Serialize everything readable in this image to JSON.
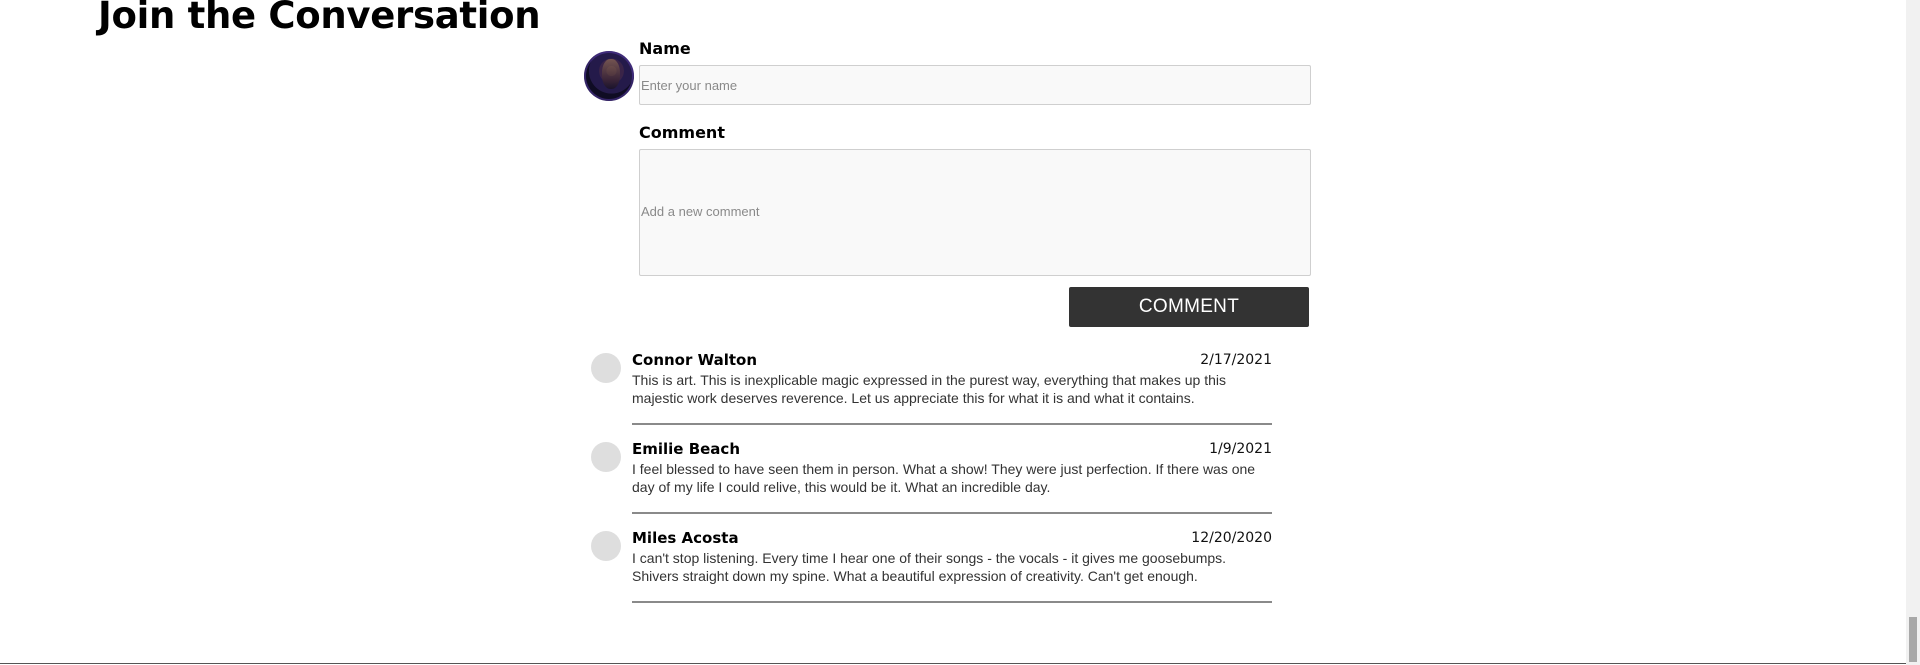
{
  "section": {
    "title": "Join the Conversation"
  },
  "form": {
    "name_label": "Name",
    "name_placeholder": "Enter your name",
    "name_value": "",
    "comment_label": "Comment",
    "comment_placeholder": "Add a new comment",
    "comment_value": "",
    "submit_label": "COMMENT"
  },
  "comments": [
    {
      "author": "Connor Walton",
      "date": "2/17/2021",
      "text": "This is art. This is inexplicable magic expressed in the purest way, everything that makes up this majestic work deserves reverence. Let us appreciate this for what it is and what it contains."
    },
    {
      "author": "Emilie Beach",
      "date": "1/9/2021",
      "text": "I feel blessed to have seen them in person. What a show! They were just perfection. If there was one day of my life I could relive, this would be it. What an incredible day."
    },
    {
      "author": "Miles Acosta",
      "date": "12/20/2020",
      "text": "I can't stop listening. Every time I hear one of their songs - the vocals - it gives me goosebumps. Shivers straight down my spine. What a beautiful expression of creativity. Can't get enough."
    }
  ],
  "colors": {
    "button_bg": "#333333",
    "field_bg": "#f9f9f9",
    "avatar_placeholder": "#dedede",
    "divider": "#8a8a8a"
  },
  "icons": {
    "user_avatar": "user-avatar-photo",
    "commenter_avatar": "avatar-placeholder-circle"
  }
}
